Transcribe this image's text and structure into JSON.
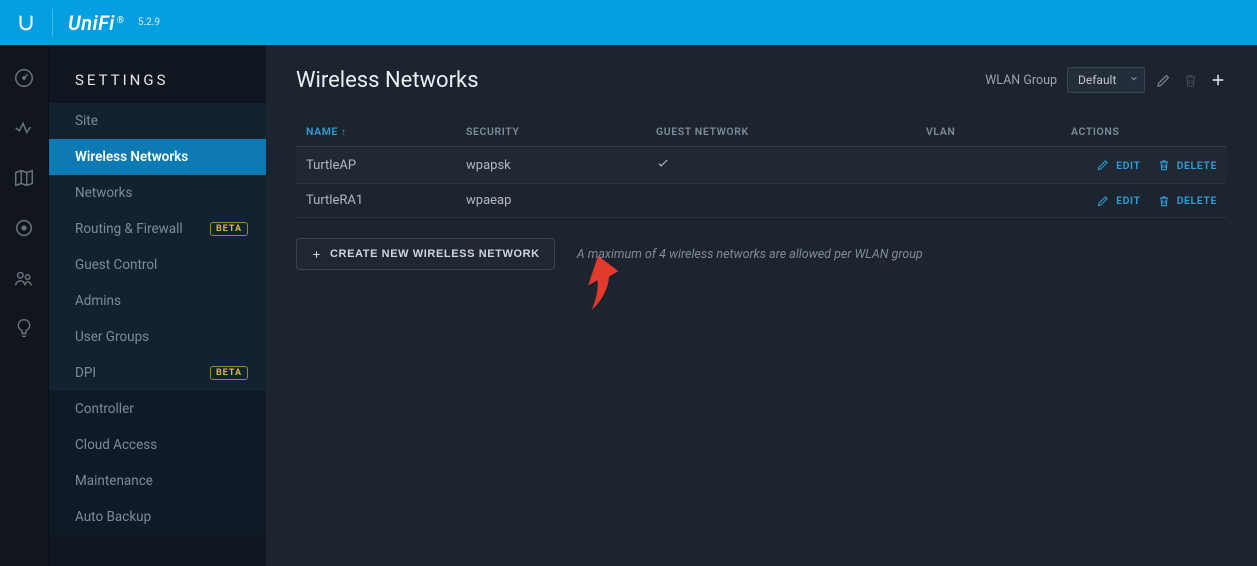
{
  "topbar": {
    "brand": "UniFi",
    "version": "5.2.9"
  },
  "sidebar": {
    "title": "SETTINGS",
    "groups": [
      {
        "style": "a",
        "items": [
          {
            "label": "Site",
            "active": false
          },
          {
            "label": "Wireless Networks",
            "active": true
          },
          {
            "label": "Networks",
            "active": false
          },
          {
            "label": "Routing & Firewall",
            "active": false,
            "beta": true
          },
          {
            "label": "Guest Control",
            "active": false
          },
          {
            "label": "Admins",
            "active": false
          },
          {
            "label": "User Groups",
            "active": false
          },
          {
            "label": "DPI",
            "active": false,
            "beta": true
          }
        ]
      },
      {
        "style": "b",
        "items": [
          {
            "label": "Controller",
            "active": false
          },
          {
            "label": "Cloud Access",
            "active": false
          },
          {
            "label": "Maintenance",
            "active": false
          },
          {
            "label": "Auto Backup",
            "active": false
          }
        ]
      }
    ],
    "beta_label": "BETA"
  },
  "page": {
    "title": "Wireless Networks",
    "wlan_group_label": "WLAN Group",
    "wlan_group_selected": "Default"
  },
  "table": {
    "headers": {
      "name": "NAME",
      "security": "SECURITY",
      "guest": "GUEST NETWORK",
      "vlan": "VLAN",
      "actions": "ACTIONS"
    },
    "rows": [
      {
        "name": "TurtleAP",
        "security": "wpapsk",
        "guest": true,
        "vlan": ""
      },
      {
        "name": "TurtleRA1",
        "security": "wpaeap",
        "guest": false,
        "vlan": ""
      }
    ],
    "edit_label": "EDIT",
    "delete_label": "DELETE"
  },
  "create": {
    "button": "CREATE NEW WIRELESS NETWORK",
    "hint": "A maximum of 4 wireless networks are allowed per WLAN group"
  }
}
